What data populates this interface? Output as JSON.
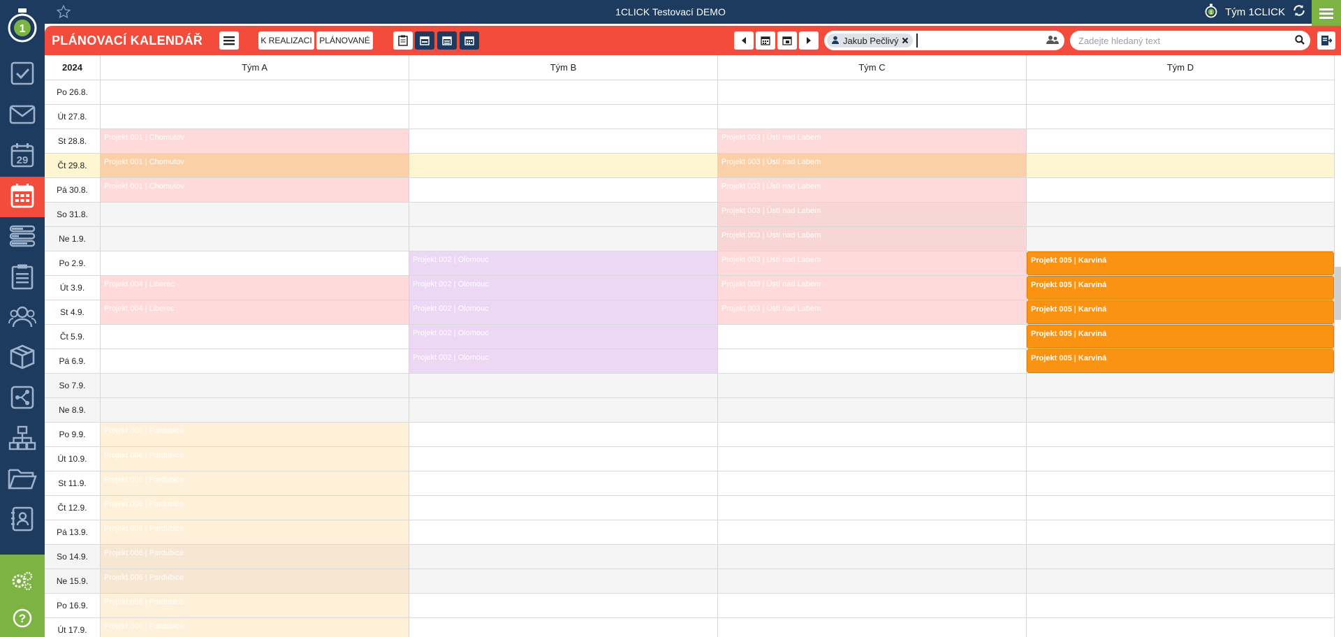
{
  "app": {
    "title": "1CLICK Testovací DEMO",
    "team_name": "Tým 1CLICK"
  },
  "toolbar": {
    "title": "PLÁNOVACÍ KALENDÁŘ",
    "btn_realizace": "K REALIZACI",
    "btn_planovane": "PLÁNOVANÉ",
    "user_chip": "Jakub Pečlivý",
    "search_placeholder": "Zadejte hledaný text"
  },
  "calendar": {
    "year": "2024",
    "teams": [
      "Tým A",
      "Tým B",
      "Tým C",
      "Tým D"
    ],
    "rows": [
      {
        "date": "Po 26.8.",
        "type": "normal"
      },
      {
        "date": "Út 27.8.",
        "type": "normal"
      },
      {
        "date": "St 28.8.",
        "type": "normal"
      },
      {
        "date": "Čt 29.8.",
        "type": "today"
      },
      {
        "date": "Pá 30.8.",
        "type": "normal"
      },
      {
        "date": "So 31.8.",
        "type": "weekend"
      },
      {
        "date": "Ne 1.9.",
        "type": "weekend"
      },
      {
        "date": "Po 2.9.",
        "type": "normal"
      },
      {
        "date": "Út 3.9.",
        "type": "normal"
      },
      {
        "date": "St 4.9.",
        "type": "normal"
      },
      {
        "date": "Čt 5.9.",
        "type": "normal"
      },
      {
        "date": "Pá 6.9.",
        "type": "normal"
      },
      {
        "date": "So 7.9.",
        "type": "weekend"
      },
      {
        "date": "Ne 8.9.",
        "type": "weekend"
      },
      {
        "date": "Po 9.9.",
        "type": "normal"
      },
      {
        "date": "Út 10.9.",
        "type": "normal"
      },
      {
        "date": "St 11.9.",
        "type": "normal"
      },
      {
        "date": "Čt 12.9.",
        "type": "normal"
      },
      {
        "date": "Pá 13.9.",
        "type": "normal"
      },
      {
        "date": "So 14.9.",
        "type": "weekend"
      },
      {
        "date": "Ne 15.9.",
        "type": "weekend"
      },
      {
        "date": "Po 16.9.",
        "type": "normal"
      },
      {
        "date": "Út 17.9.",
        "type": "normal"
      }
    ],
    "events": [
      {
        "team": 0,
        "row": 2,
        "label": "Projekt 001 | Chomutov",
        "style": "pink"
      },
      {
        "team": 0,
        "row": 3,
        "label": "Projekt 001 | Chomutov",
        "style": "pink"
      },
      {
        "team": 0,
        "row": 4,
        "label": "Projekt 001 | Chomutov",
        "style": "pink"
      },
      {
        "team": 2,
        "row": 2,
        "label": "Projekt 003 | Ústí nad Labem",
        "style": "pink"
      },
      {
        "team": 2,
        "row": 3,
        "label": "Projekt 003 | Ústí nad Labem",
        "style": "pink"
      },
      {
        "team": 2,
        "row": 4,
        "label": "Projekt 003 | Ústí nad Labem",
        "style": "pink"
      },
      {
        "team": 2,
        "row": 5,
        "label": "Projekt 003 | Ústí nad Labem",
        "style": "pink"
      },
      {
        "team": 2,
        "row": 6,
        "label": "Projekt 003 | Ústí nad Labem",
        "style": "pink"
      },
      {
        "team": 2,
        "row": 7,
        "label": "Projekt 003 | Ústí nad Labem",
        "style": "pink"
      },
      {
        "team": 2,
        "row": 8,
        "label": "Projekt 003 | Ústí nad Labem",
        "style": "pink"
      },
      {
        "team": 2,
        "row": 9,
        "label": "Projekt 003 | Ústí nad Labem",
        "style": "pink"
      },
      {
        "team": 1,
        "row": 7,
        "label": "Projekt 002 | Olomouc",
        "style": "purple"
      },
      {
        "team": 1,
        "row": 8,
        "label": "Projekt 002 | Olomouc",
        "style": "purple"
      },
      {
        "team": 1,
        "row": 9,
        "label": "Projekt 002 | Olomouc",
        "style": "purple"
      },
      {
        "team": 1,
        "row": 10,
        "label": "Projekt 002 | Olomouc",
        "style": "purple"
      },
      {
        "team": 1,
        "row": 11,
        "label": "Projekt 002 | Olomouc",
        "style": "purple"
      },
      {
        "team": 3,
        "row": 7,
        "label": "Projekt 005 | Karviná",
        "style": "orange"
      },
      {
        "team": 3,
        "row": 8,
        "label": "Projekt 005 | Karviná",
        "style": "orange"
      },
      {
        "team": 3,
        "row": 9,
        "label": "Projekt 005 | Karviná",
        "style": "orange"
      },
      {
        "team": 3,
        "row": 10,
        "label": "Projekt 005 | Karviná",
        "style": "orange"
      },
      {
        "team": 3,
        "row": 11,
        "label": "Projekt 005 | Karviná",
        "style": "orange"
      },
      {
        "team": 0,
        "row": 8,
        "label": "Projekt 004 | Liberec",
        "style": "pink"
      },
      {
        "team": 0,
        "row": 9,
        "label": "Projekt 004 | Liberec",
        "style": "pink"
      },
      {
        "team": 0,
        "row": 14,
        "label": "Projekt 006 | Pardubice",
        "style": "cream"
      },
      {
        "team": 0,
        "row": 15,
        "label": "Projekt 006 | Pardubice",
        "style": "cream"
      },
      {
        "team": 0,
        "row": 16,
        "label": "Projekt 006 | Pardubice",
        "style": "cream"
      },
      {
        "team": 0,
        "row": 17,
        "label": "Projekt 006 | Pardubice",
        "style": "cream"
      },
      {
        "team": 0,
        "row": 18,
        "label": "Projekt 006 | Pardubice",
        "style": "cream"
      },
      {
        "team": 0,
        "row": 19,
        "label": "Projekt 006 | Pardubice",
        "style": "cream"
      },
      {
        "team": 0,
        "row": 20,
        "label": "Projekt 006 | Pardubice",
        "style": "cream"
      },
      {
        "team": 0,
        "row": 21,
        "label": "Projekt 006 | Pardubice",
        "style": "cream"
      },
      {
        "team": 0,
        "row": 22,
        "label": "Projekt 006 | Pardubice",
        "style": "cream"
      }
    ]
  },
  "sidebar": {
    "items": [
      {
        "name": "tasks-icon",
        "active": false
      },
      {
        "name": "mail-icon",
        "active": false
      },
      {
        "name": "calendar-day-icon",
        "active": false
      },
      {
        "name": "planning-calendar-icon",
        "active": true
      },
      {
        "name": "layers-icon",
        "active": false
      },
      {
        "name": "clipboard-icon",
        "active": false
      },
      {
        "name": "contacts-icon",
        "active": false
      },
      {
        "name": "products-icon",
        "active": false
      },
      {
        "name": "workflow-icon",
        "active": false
      },
      {
        "name": "org-chart-icon",
        "active": false
      },
      {
        "name": "folder-icon",
        "active": false
      },
      {
        "name": "address-book-icon",
        "active": false
      }
    ],
    "calendar_day": "29"
  },
  "colors": {
    "navy": "#1d3a5f",
    "red": "#f44c3c",
    "green": "#7cb342",
    "orange": "#fb9312"
  }
}
